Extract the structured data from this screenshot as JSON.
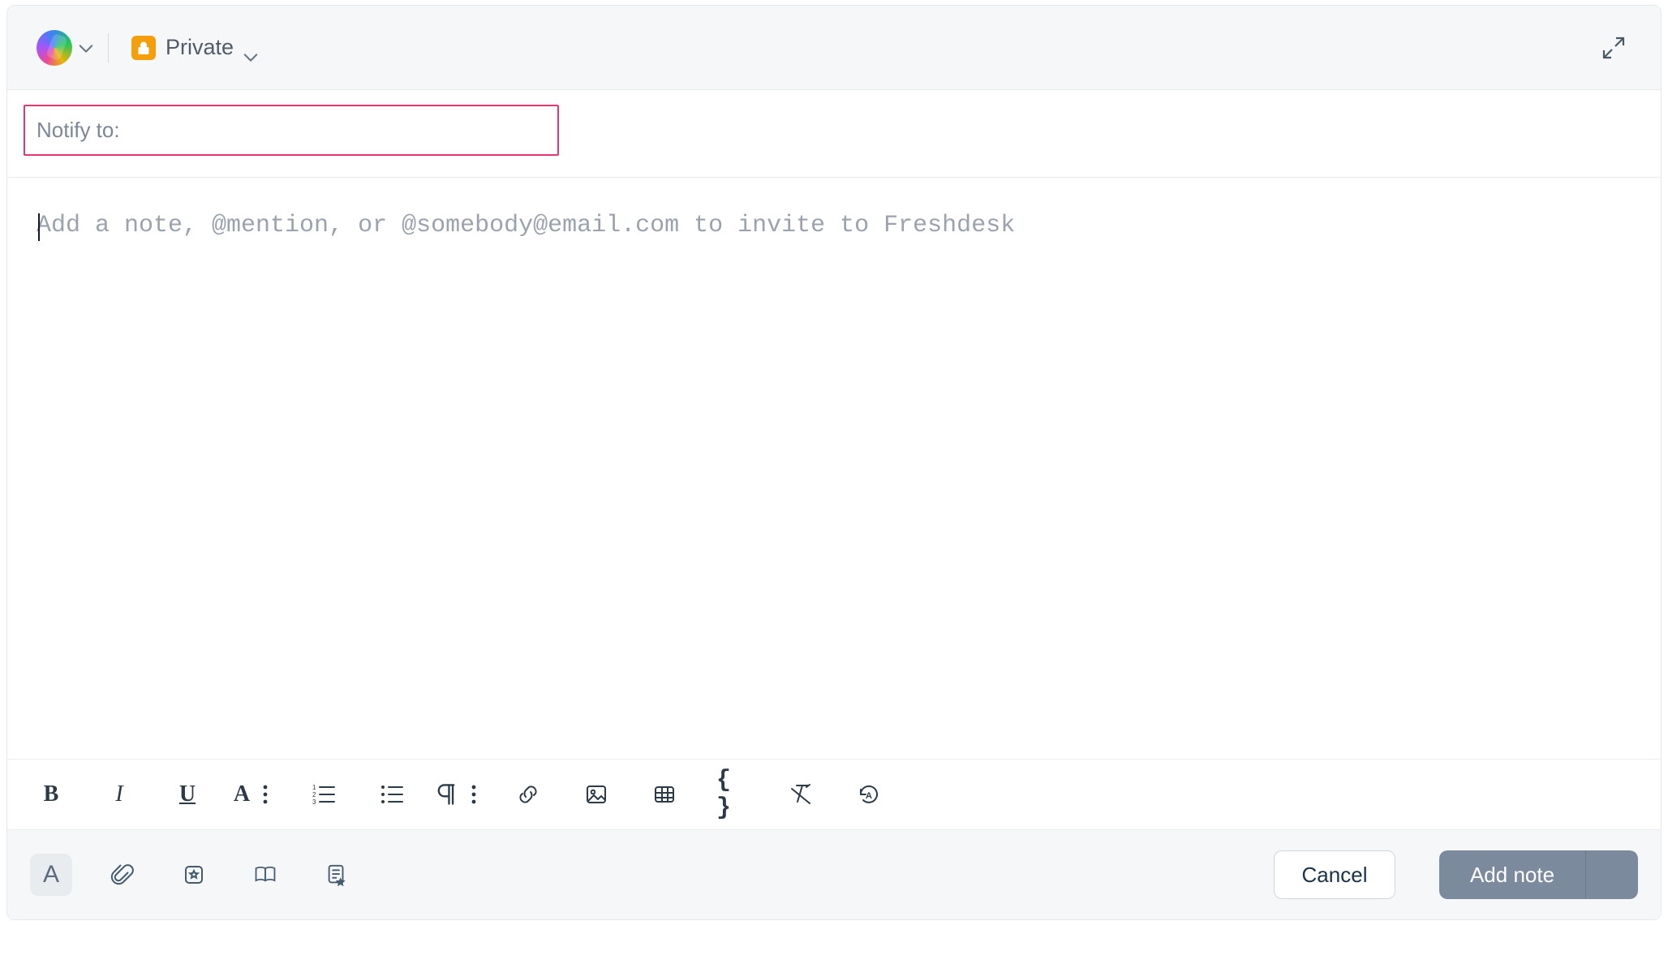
{
  "header": {
    "privacy_label": "Private"
  },
  "notify": {
    "label": "Notify to:"
  },
  "editor": {
    "placeholder": "Add a note, @mention, or @somebody@email.com to invite to Freshdesk",
    "value": ""
  },
  "format_toolbar": {
    "items": [
      {
        "name": "bold-icon"
      },
      {
        "name": "italic-icon"
      },
      {
        "name": "underline-icon"
      },
      {
        "name": "font-options-icon"
      },
      {
        "name": "ordered-list-icon"
      },
      {
        "name": "unordered-list-icon"
      },
      {
        "name": "paragraph-options-icon"
      },
      {
        "name": "link-icon"
      },
      {
        "name": "image-icon"
      },
      {
        "name": "table-icon"
      },
      {
        "name": "code-icon"
      },
      {
        "name": "clear-format-icon"
      },
      {
        "name": "undo-history-icon"
      }
    ]
  },
  "footer_left": {
    "items": [
      {
        "name": "text-format-toggle-icon"
      },
      {
        "name": "attachment-icon"
      },
      {
        "name": "canned-response-icon"
      },
      {
        "name": "knowledge-base-icon"
      },
      {
        "name": "template-icon"
      }
    ]
  },
  "footer": {
    "cancel_label": "Cancel",
    "submit_label": "Add note"
  },
  "colors": {
    "accent_warning": "#f59e0b",
    "highlight_border": "#e6356f",
    "primary_button": "#7b8a9c"
  }
}
